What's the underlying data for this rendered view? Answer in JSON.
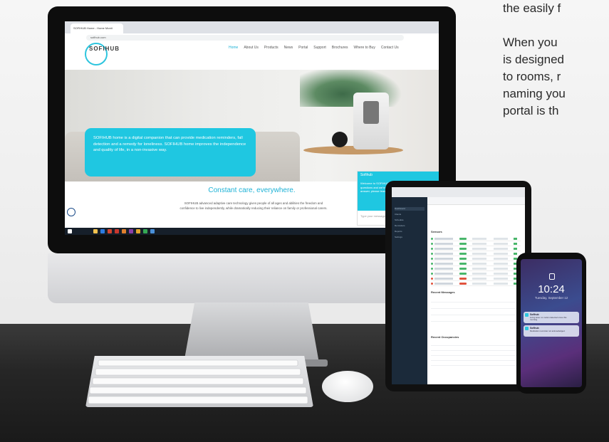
{
  "side_text": {
    "lines": [
      "the easily f",
      "",
      "When you",
      "is designed",
      "to rooms, r",
      "naming you",
      "portal is th"
    ]
  },
  "browser": {
    "tab_title": "SOFIHUB Home - Home Monit",
    "url": "sofihub.com"
  },
  "site": {
    "logo": "SOFIHUB",
    "nav": [
      "Home",
      "About Us",
      "Products",
      "News",
      "Portal",
      "Support",
      "Brochures",
      "Where to Buy",
      "Contact Us"
    ],
    "active_nav": "Home",
    "hero_text": "SOFIHUB home is a digital companion that can provide medication reminders, fall detection and a remedy for loneliness. SOFIHUB home improves the independence and quality of life, in a non-invasive way.",
    "device_label": "SOFIHUB",
    "headline": "Constant care, everywhere.",
    "body": "SOFIHUB advanced adaptive care technology gives people of all ages and abilities the freedom and confidence to live independently, while dramatically reducing their reliance on family or professional carers.",
    "chat": {
      "title": "Sofihub",
      "message": "Welcome to SOFIHUB. Please let us know if you have any questions and we're happy to help. If you would like an answer, please leave your email address.",
      "placeholder": "Type your message..."
    }
  },
  "tablet": {
    "sidebar_items": [
      "Dashboard",
      "Clients",
      "Schedule",
      "Reminders",
      "Reports",
      "Settings"
    ],
    "sections": [
      "Sensors",
      "Recent Messages",
      "Recent Occupancies"
    ]
  },
  "phone": {
    "time": "10:24",
    "date": "Tuesday, September 12",
    "notifications": [
      {
        "title": "Sofihub",
        "body": "Living area: no motion detected since this morning."
      },
      {
        "title": "Sofihub",
        "body": "Medication reminder not acknowledged."
      }
    ]
  },
  "colors": {
    "brand": "#1fc7e1",
    "screen_frame": "#0d0d0d",
    "desk": "#1a1a1a"
  }
}
